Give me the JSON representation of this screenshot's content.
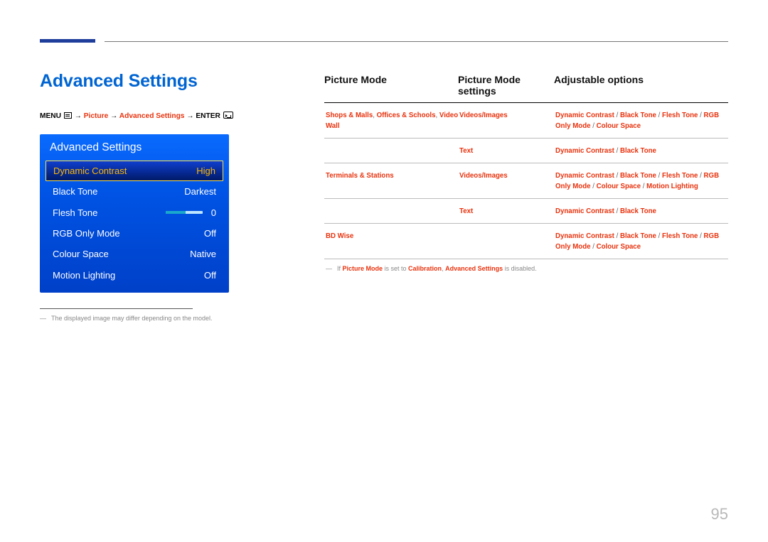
{
  "page_number": "95",
  "section_title": "Advanced Settings",
  "breadcrumb": {
    "menu_label": "MENU",
    "picture": "Picture",
    "advanced": "Advanced Settings",
    "enter_label": "ENTER"
  },
  "osd": {
    "title": "Advanced Settings",
    "rows": [
      {
        "label": "Dynamic Contrast",
        "value": "High",
        "selected": true
      },
      {
        "label": "Black Tone",
        "value": "Darkest"
      },
      {
        "label": "Flesh Tone",
        "value": "0",
        "slider": true
      },
      {
        "label": "RGB Only Mode",
        "value": "Off"
      },
      {
        "label": "Colour Space",
        "value": "Native"
      },
      {
        "label": "Motion Lighting",
        "value": "Off"
      }
    ]
  },
  "left_footnote": "The displayed image may differ depending on the model.",
  "table": {
    "headers": {
      "c1": "Picture Mode",
      "c2": "Picture Mode settings",
      "c3": "Adjustable options"
    },
    "rows": [
      {
        "c1": [
          "Shops & Malls",
          "Offices & Schools",
          "Video Wall"
        ],
        "c2": "Videos/Images",
        "c3": [
          "Dynamic Contrast",
          "Black Tone",
          "Flesh Tone",
          "RGB Only Mode",
          "Colour Space"
        ]
      },
      {
        "c1": [],
        "c2": "Text",
        "c3": [
          "Dynamic Contrast",
          "Black Tone"
        ]
      },
      {
        "c1": [
          "Terminals & Stations"
        ],
        "c2": "Videos/Images",
        "c3": [
          "Dynamic Contrast",
          "Black Tone",
          "Flesh Tone",
          "RGB Only Mode",
          "Colour Space",
          "Motion Lighting"
        ]
      },
      {
        "c1": [],
        "c2": "Text",
        "c3": [
          "Dynamic Contrast",
          "Black Tone"
        ]
      },
      {
        "c1": [
          "BD Wise"
        ],
        "c2": "",
        "c3": [
          "Dynamic Contrast",
          "Black Tone",
          "Flesh Tone",
          "RGB Only Mode",
          "Colour Space"
        ]
      }
    ]
  },
  "note": {
    "prefix": "If ",
    "pm": "Picture Mode",
    "mid": " is set to ",
    "cal": "Calibration",
    "mid2": ", ",
    "adv": "Advanced Settings",
    "suffix": " is disabled."
  }
}
